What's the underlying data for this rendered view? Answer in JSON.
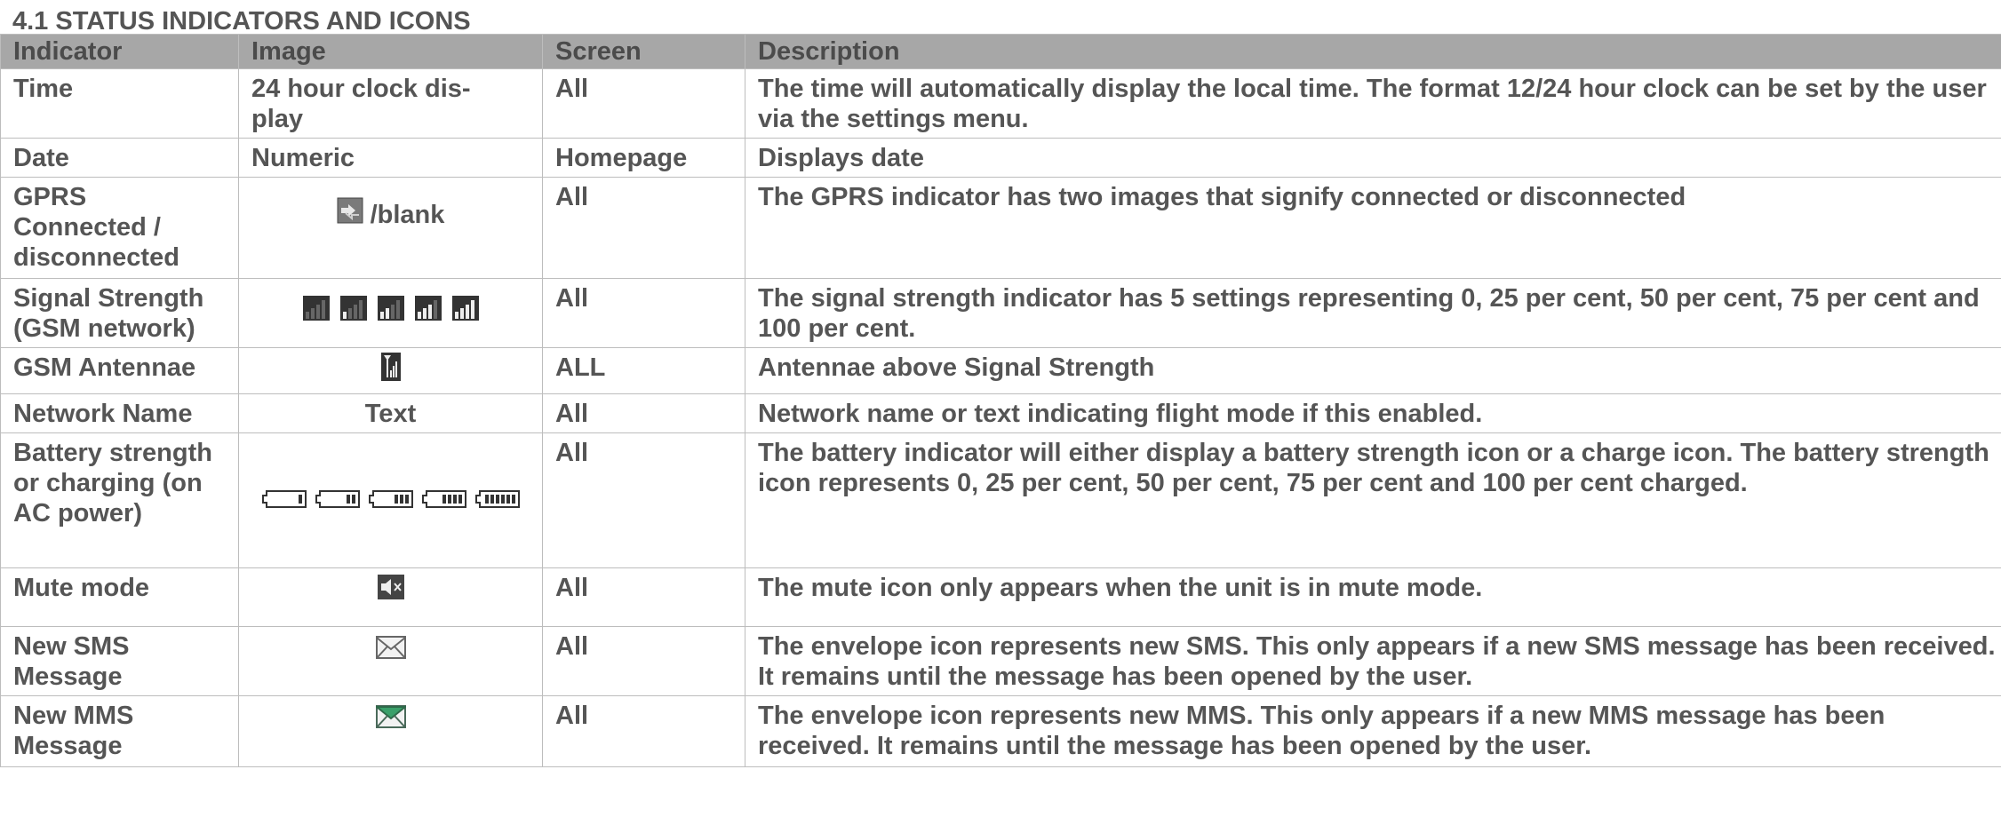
{
  "section_title": "4.1 STATUS INDICATORS AND ICONS",
  "headers": [
    "Indicator",
    "Image",
    "Screen",
    "Description"
  ],
  "rows": [
    {
      "indicator": "Time",
      "image_text": "24 hour clock dis-play",
      "screen": "All",
      "description": "The time will automatically display the local time. The format 12/24 hour clock can be set by the user via the settings menu."
    },
    {
      "indicator": "Date",
      "image_text": "Numeric",
      "screen": "Homepage",
      "description": "Displays date"
    },
    {
      "indicator": "GPRS Connected / disconnected",
      "image_text": "/blank",
      "image_icon": "gprs-icon",
      "screen": "All",
      "description": "The GPRS indicator has two images that signify connected or disconnected"
    },
    {
      "indicator": "Signal Strength (GSM network)",
      "image_icon": "signal-strength-icons",
      "screen": "All",
      "description": "The signal strength indicator has 5 settings representing 0, 25 per cent, 50 per cent, 75 per cent and 100 per cent."
    },
    {
      "indicator": "GSM Antennae",
      "image_icon": "antenna-icon",
      "screen": "ALL",
      "description": "Antennae above Signal Strength"
    },
    {
      "indicator": "Network Name",
      "image_text": "Text",
      "screen": "All",
      "description": "Network name or text indicating flight mode if this enabled."
    },
    {
      "indicator": "Battery strength or charging (on AC power)",
      "image_icon": "battery-icons",
      "screen": "All",
      "description": "The battery indicator will either display a battery strength icon or a charge icon. The battery strength icon represents 0, 25 per cent, 50 per cent, 75 per cent and 100 per cent charged."
    },
    {
      "indicator": "Mute mode",
      "image_icon": "mute-icon",
      "screen": "All",
      "description": "The mute icon only appears when the unit is in mute mode."
    },
    {
      "indicator": "New SMS Message",
      "image_icon": "envelope-icon",
      "screen": "All",
      "description": "The envelope icon represents new SMS. This only appears if a new SMS message has been received. It remains until the message has been opened by the user."
    },
    {
      "indicator": "New MMS Message",
      "image_icon": "envelope-green-icon",
      "screen": "All",
      "description": "The envelope icon represents new MMS. This only appears if a new MMS message has been received. It remains until the message has been opened by the user."
    }
  ]
}
